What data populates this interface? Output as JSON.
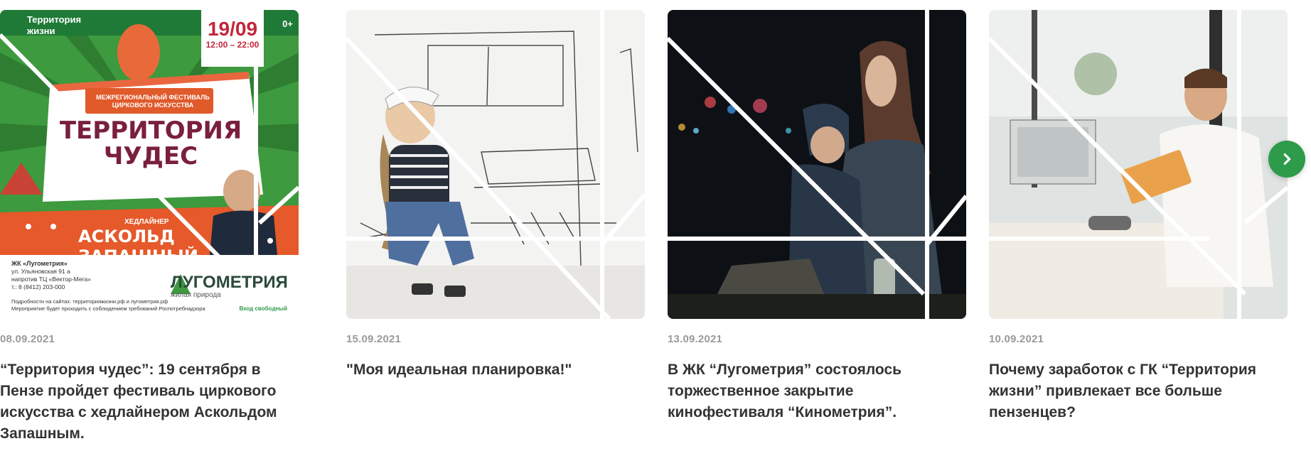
{
  "nav": {
    "prev_icon": "chevron-left-icon",
    "next_icon": "chevron-right-icon",
    "accent": "#2e9b4a"
  },
  "cards": [
    {
      "date": "15.09.2021",
      "title": "\"Моя идеальная планировка!\""
    },
    {
      "date": "13.09.2021",
      "title": "В ЖК “Лугометрия” состоялось торжественное закрытие кинофестиваля “Кинометрия”."
    },
    {
      "date": "10.09.2021",
      "title": "Почему заработок с ГК “Территория жизни” привлекает все больше пензенцев?"
    },
    {
      "date": "08.09.2021",
      "title": "“Территория чудес”: 19 сентября в Пензе пройдет фестиваль циркового искусства с хедлайнером Аскольдом Запашным.",
      "poster": {
        "label_line1": "Территория",
        "label_line2": "жизни",
        "age": "0+",
        "date": "19/09",
        "time": "12:00 – 22:00",
        "subtitle_line1": "МЕЖРЕГИОНАЛЬНЫЙ ФЕСТИВАЛЬ",
        "subtitle_line2": "ЦИРКОВОГО ИСКУССТВА",
        "main_line1": "ТЕРРИТОРИЯ",
        "main_line2": "ЧУДЕС",
        "headliner_label": "ХЕДЛАЙНЕР",
        "headliner": "АСКОЛЬД ЗАПАШНЫЙ",
        "contact_name": "ЖК «Лугометрия»",
        "contact_line1": "ул. Ульяновская 91 а",
        "contact_line2": "напротив ТЦ «Вектор-Мега»",
        "contact_phone": "т.: 8 (8412) 203-000",
        "brand": "ЛУГОМЕТРИЯ",
        "brand_sub": "жилая природа",
        "footer_line1": "Подробности на сайтах: территорияжизни.рф и лугометрия.рф",
        "footer_line2": "Мероприятие будет проходить с соблюдением требований Роспотребнадзора",
        "free": "Вход свободный"
      }
    }
  ]
}
